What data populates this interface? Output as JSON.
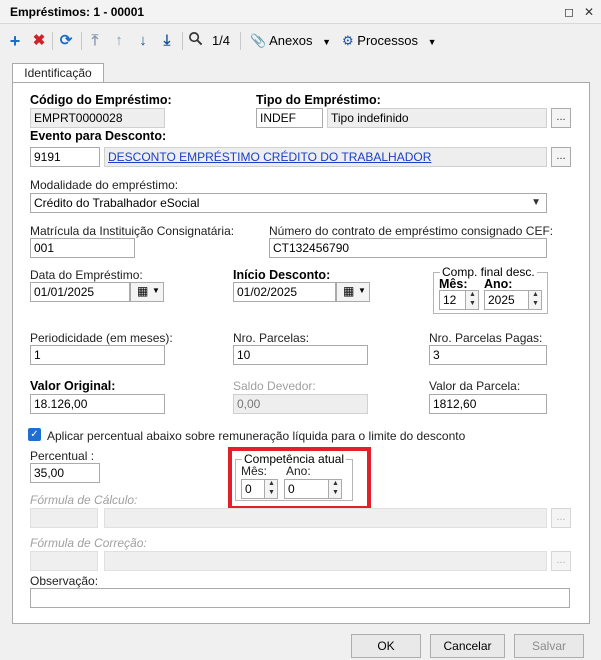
{
  "window": {
    "title": "Empréstimos: 1 - 00001"
  },
  "toolbar": {
    "record_position": "1/4",
    "anexos_label": "Anexos",
    "processos_label": "Processos"
  },
  "tabs": [
    {
      "label": "Identificação"
    }
  ],
  "form": {
    "codigo": {
      "label": "Código do Empréstimo:",
      "value": "EMPRT0000028"
    },
    "tipo": {
      "label": "Tipo do Empréstimo:",
      "code": "INDEF",
      "description": "Tipo indefinido"
    },
    "evento": {
      "label": "Evento para Desconto:",
      "code": "9191",
      "description": "DESCONTO EMPRÉSTIMO CRÉDITO DO TRABALHADOR"
    },
    "modalidade": {
      "label": "Modalidade do empréstimo:",
      "value": "Crédito do Trabalhador eSocial"
    },
    "matricula": {
      "label": "Matrícula da Instituição Consignatária:",
      "value": "001"
    },
    "contrato": {
      "label": "Número do contrato de empréstimo consignado CEF:",
      "value": "CT132456790"
    },
    "data_emprestimo": {
      "label": "Data do Empréstimo:",
      "value": "01/01/2025"
    },
    "inicio_desconto": {
      "label": "Início Desconto:",
      "value": "01/02/2025"
    },
    "comp_final": {
      "title": "Comp. final desc.",
      "mes_label": "Mês:",
      "ano_label": "Ano:",
      "mes": "12",
      "ano": "2025"
    },
    "periodicidade": {
      "label": "Periodicidade (em meses):",
      "value": "1"
    },
    "nro_parcelas": {
      "label": "Nro. Parcelas:",
      "value": "10"
    },
    "nro_parcelas_pagas": {
      "label": "Nro. Parcelas Pagas:",
      "value": "3"
    },
    "valor_original": {
      "label": "Valor Original:",
      "value": "18.126,00"
    },
    "saldo_devedor": {
      "label": "Saldo Devedor:",
      "value": "0,00"
    },
    "valor_parcela": {
      "label": "Valor da Parcela:",
      "value": "1812,60"
    },
    "aplicar_percentual": {
      "label": "Aplicar percentual abaixo sobre remuneração líquida para o limite do desconto",
      "checked": true
    },
    "percentual": {
      "label": "Percentual :",
      "value": "35,00"
    },
    "competencia_atual": {
      "title": "Competência atual",
      "mes_label": "Mês:",
      "ano_label": "Ano:",
      "mes": "0",
      "ano": "0"
    },
    "formula_calculo": {
      "label": "Fórmula de Cálculo:"
    },
    "formula_correcao": {
      "label": "Fórmula de Correção:"
    },
    "observacao": {
      "label": "Observação:"
    }
  },
  "footer": {
    "ok_label": "OK",
    "cancel_label": "Cancelar",
    "save_label": "Salvar"
  },
  "colors": {
    "highlight_box": "#e0202a",
    "link": "#1a3fc8",
    "checkbox": "#1e6fd0"
  },
  "icons": [
    "add-icon",
    "delete-icon",
    "refresh-icon",
    "first-record-icon",
    "previous-record-icon",
    "next-record-icon",
    "last-record-icon",
    "search-icon",
    "attachment-icon",
    "gear-icon",
    "calendar-icon"
  ]
}
